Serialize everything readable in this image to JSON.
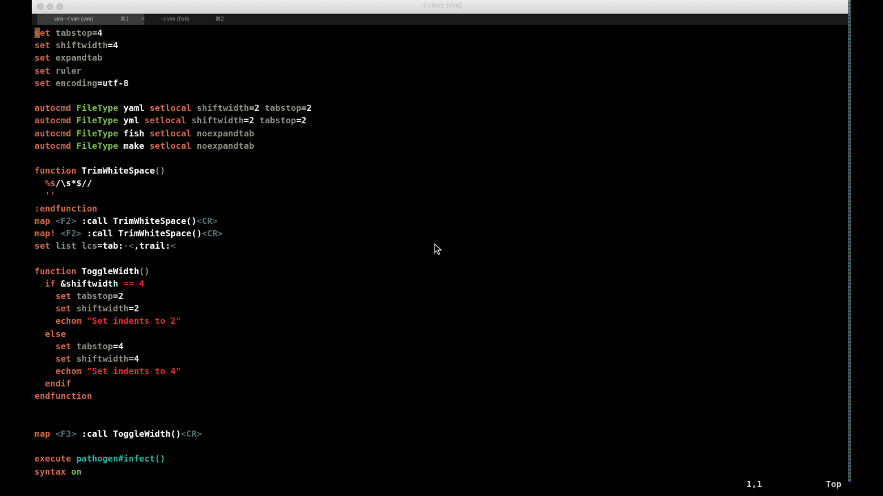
{
  "window": {
    "title": "~/.vimrc (vim)"
  },
  "tabs": [
    {
      "label": "vim ~/.vim (vim)",
      "shortcut": "⌘1"
    },
    {
      "label": "~/.vim (fish)",
      "shortcut": "⌘2"
    }
  ],
  "colors": {
    "text": "#d0d0d0",
    "keyword": "#cf6a4c",
    "option": "#8a8f80",
    "type": "#7ab94c",
    "identifier": "#ffffff",
    "string": "#e0312b",
    "special": "#5a6e73",
    "func": "#2fb5a6",
    "number": "#e8e8e8",
    "cursor": "#7a5a3a"
  },
  "editor": {
    "lines": [
      [
        [
          "s",
          "cursor"
        ],
        [
          "et",
          "keyword"
        ],
        [
          " ",
          ""
        ],
        [
          "tabstop",
          "option"
        ],
        [
          "=4",
          "number"
        ]
      ],
      [
        [
          "set",
          "keyword"
        ],
        [
          " ",
          ""
        ],
        [
          "shiftwidth",
          "option"
        ],
        [
          "=4",
          "number"
        ]
      ],
      [
        [
          "set",
          "keyword"
        ],
        [
          " ",
          ""
        ],
        [
          "expandtab",
          "option"
        ]
      ],
      [
        [
          "set",
          "keyword"
        ],
        [
          " ",
          ""
        ],
        [
          "ruler",
          "option"
        ]
      ],
      [
        [
          "set",
          "keyword"
        ],
        [
          " ",
          ""
        ],
        [
          "encoding",
          "option"
        ],
        [
          "=utf-8",
          "number"
        ]
      ],
      [],
      [
        [
          "autocmd",
          "keyword"
        ],
        [
          " ",
          ""
        ],
        [
          "FileType",
          "type"
        ],
        [
          " yaml ",
          "identifier"
        ],
        [
          "setlocal",
          "keyword"
        ],
        [
          " ",
          ""
        ],
        [
          "shiftwidth",
          "option"
        ],
        [
          "=2 ",
          "number"
        ],
        [
          "tabstop",
          "option"
        ],
        [
          "=2",
          "number"
        ]
      ],
      [
        [
          "autocmd",
          "keyword"
        ],
        [
          " ",
          ""
        ],
        [
          "FileType",
          "type"
        ],
        [
          " yml ",
          "identifier"
        ],
        [
          "setlocal",
          "keyword"
        ],
        [
          " ",
          ""
        ],
        [
          "shiftwidth",
          "option"
        ],
        [
          "=2 ",
          "number"
        ],
        [
          "tabstop",
          "option"
        ],
        [
          "=2",
          "number"
        ]
      ],
      [
        [
          "autocmd",
          "keyword"
        ],
        [
          " ",
          ""
        ],
        [
          "FileType",
          "type"
        ],
        [
          " fish ",
          "identifier"
        ],
        [
          "setlocal",
          "keyword"
        ],
        [
          " ",
          ""
        ],
        [
          "noexpandtab",
          "option"
        ]
      ],
      [
        [
          "autocmd",
          "keyword"
        ],
        [
          " ",
          ""
        ],
        [
          "FileType",
          "type"
        ],
        [
          " make ",
          "identifier"
        ],
        [
          "setlocal",
          "keyword"
        ],
        [
          " ",
          ""
        ],
        [
          "noexpandtab",
          "option"
        ]
      ],
      [],
      [
        [
          "function",
          "keyword"
        ],
        [
          " TrimWhiteSpace",
          "identifier"
        ],
        [
          "()",
          "option"
        ]
      ],
      [
        [
          "  ",
          ""
        ],
        [
          "%s",
          "keyword"
        ],
        [
          "/\\s*$//",
          "identifier"
        ]
      ],
      [
        [
          "  ",
          ""
        ],
        [
          "''",
          "keyword"
        ]
      ],
      [
        [
          ":endfunction",
          "keyword"
        ]
      ],
      [
        [
          "map",
          "keyword"
        ],
        [
          " ",
          ""
        ],
        [
          "<F2>",
          "special"
        ],
        [
          " :call TrimWhiteSpace()",
          "identifier"
        ],
        [
          "<CR>",
          "special"
        ]
      ],
      [
        [
          "map!",
          "keyword"
        ],
        [
          " ",
          ""
        ],
        [
          "<F2>",
          "special"
        ],
        [
          " :call TrimWhiteSpace()",
          "identifier"
        ],
        [
          "<CR>",
          "special"
        ]
      ],
      [
        [
          "set",
          "keyword"
        ],
        [
          " ",
          ""
        ],
        [
          "list",
          "option"
        ],
        [
          " ",
          ""
        ],
        [
          "lcs",
          "option"
        ],
        [
          "=tab:",
          "identifier"
        ],
        [
          "·<",
          "special"
        ],
        [
          ",trail:",
          "identifier"
        ],
        [
          "<",
          "special"
        ]
      ],
      [],
      [
        [
          "function",
          "keyword"
        ],
        [
          " ToggleWidth",
          "identifier"
        ],
        [
          "()",
          "option"
        ]
      ],
      [
        [
          "  ",
          ""
        ],
        [
          "if",
          "keyword"
        ],
        [
          " &shiftwidth ",
          "identifier"
        ],
        [
          "== 4",
          "string"
        ]
      ],
      [
        [
          "    ",
          ""
        ],
        [
          "set",
          "keyword"
        ],
        [
          " ",
          ""
        ],
        [
          "tabstop",
          "option"
        ],
        [
          "=2",
          "number"
        ]
      ],
      [
        [
          "    ",
          ""
        ],
        [
          "set",
          "keyword"
        ],
        [
          " ",
          ""
        ],
        [
          "shiftwidth",
          "option"
        ],
        [
          "=2",
          "number"
        ]
      ],
      [
        [
          "    ",
          ""
        ],
        [
          "echom",
          "keyword"
        ],
        [
          " \"Set indents to 2\"",
          "string"
        ]
      ],
      [
        [
          "  ",
          ""
        ],
        [
          "else",
          "keyword"
        ]
      ],
      [
        [
          "    ",
          ""
        ],
        [
          "set",
          "keyword"
        ],
        [
          " ",
          ""
        ],
        [
          "tabstop",
          "option"
        ],
        [
          "=4",
          "number"
        ]
      ],
      [
        [
          "    ",
          ""
        ],
        [
          "set",
          "keyword"
        ],
        [
          " ",
          ""
        ],
        [
          "shiftwidth",
          "option"
        ],
        [
          "=4",
          "number"
        ]
      ],
      [
        [
          "    ",
          ""
        ],
        [
          "echom",
          "keyword"
        ],
        [
          " \"Set indents to 4\"",
          "string"
        ]
      ],
      [
        [
          "  ",
          ""
        ],
        [
          "endif",
          "keyword"
        ]
      ],
      [
        [
          "endfunction",
          "keyword"
        ]
      ],
      [],
      [],
      [
        [
          "map",
          "keyword"
        ],
        [
          " ",
          ""
        ],
        [
          "<F3>",
          "special"
        ],
        [
          " :call ToggleWidth()",
          "identifier"
        ],
        [
          "<CR>",
          "special"
        ]
      ],
      [],
      [
        [
          "execute",
          "keyword"
        ],
        [
          " ",
          ""
        ],
        [
          "pathogen#infect()",
          "func"
        ]
      ],
      [
        [
          "syntax",
          "keyword"
        ],
        [
          " ",
          ""
        ],
        [
          "on",
          "type"
        ]
      ]
    ]
  },
  "statusline": {
    "position": "1,1",
    "scroll": "Top"
  },
  "icons": {
    "pointer": "mouse-pointer-icon"
  }
}
